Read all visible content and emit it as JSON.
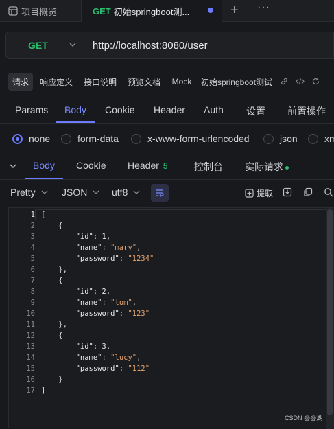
{
  "tabbar": {
    "overview_label": "项目概览",
    "active_tab": {
      "method": "GET",
      "title": "初始springboot测..."
    }
  },
  "request": {
    "method": "GET",
    "url": "http://localhost:8080/user"
  },
  "doc_tabs": [
    "请求",
    "响应定义",
    "接口说明",
    "预览文档",
    "Mock",
    "初始springboot测试"
  ],
  "param_tabs": [
    "Params",
    "Body",
    "Cookie",
    "Header",
    "Auth",
    "设置",
    "前置操作"
  ],
  "param_tabs_active": "Body",
  "body_types": [
    "none",
    "form-data",
    "x-www-form-urlencoded",
    "json",
    "xm"
  ],
  "body_type_selected": "none",
  "response_tabs": {
    "body": "Body",
    "cookie": "Cookie",
    "header": "Header",
    "header_count": "5",
    "console": "控制台",
    "actual_request": "实际请求"
  },
  "response_toolbar": {
    "format": "Pretty",
    "language": "JSON",
    "encoding": "utf8",
    "extract": "提取"
  },
  "code_lines": [
    {
      "n": "1",
      "tokens": [
        {
          "t": "brk",
          "v": "["
        }
      ]
    },
    {
      "n": "2",
      "tokens": [
        {
          "t": "brk",
          "v": "    {"
        }
      ]
    },
    {
      "n": "3",
      "tokens": [
        {
          "t": "pun",
          "v": "        "
        },
        {
          "t": "key",
          "v": "\"id\""
        },
        {
          "t": "pun",
          "v": ": "
        },
        {
          "t": "num",
          "v": "1"
        },
        {
          "t": "pun",
          "v": ","
        }
      ]
    },
    {
      "n": "4",
      "tokens": [
        {
          "t": "pun",
          "v": "        "
        },
        {
          "t": "key",
          "v": "\"name\""
        },
        {
          "t": "pun",
          "v": ": "
        },
        {
          "t": "str",
          "v": "\"mary\""
        },
        {
          "t": "pun",
          "v": ","
        }
      ]
    },
    {
      "n": "5",
      "tokens": [
        {
          "t": "pun",
          "v": "        "
        },
        {
          "t": "key",
          "v": "\"password\""
        },
        {
          "t": "pun",
          "v": ": "
        },
        {
          "t": "str",
          "v": "\"1234\""
        }
      ]
    },
    {
      "n": "6",
      "tokens": [
        {
          "t": "brk",
          "v": "    },"
        }
      ]
    },
    {
      "n": "7",
      "tokens": [
        {
          "t": "brk",
          "v": "    {"
        }
      ]
    },
    {
      "n": "8",
      "tokens": [
        {
          "t": "pun",
          "v": "        "
        },
        {
          "t": "key",
          "v": "\"id\""
        },
        {
          "t": "pun",
          "v": ": "
        },
        {
          "t": "num",
          "v": "2"
        },
        {
          "t": "pun",
          "v": ","
        }
      ]
    },
    {
      "n": "9",
      "tokens": [
        {
          "t": "pun",
          "v": "        "
        },
        {
          "t": "key",
          "v": "\"name\""
        },
        {
          "t": "pun",
          "v": ": "
        },
        {
          "t": "str",
          "v": "\"tom\""
        },
        {
          "t": "pun",
          "v": ","
        }
      ]
    },
    {
      "n": "10",
      "tokens": [
        {
          "t": "pun",
          "v": "        "
        },
        {
          "t": "key",
          "v": "\"password\""
        },
        {
          "t": "pun",
          "v": ": "
        },
        {
          "t": "str",
          "v": "\"123\""
        }
      ]
    },
    {
      "n": "11",
      "tokens": [
        {
          "t": "brk",
          "v": "    },"
        }
      ]
    },
    {
      "n": "12",
      "tokens": [
        {
          "t": "brk",
          "v": "    {"
        }
      ]
    },
    {
      "n": "13",
      "tokens": [
        {
          "t": "pun",
          "v": "        "
        },
        {
          "t": "key",
          "v": "\"id\""
        },
        {
          "t": "pun",
          "v": ": "
        },
        {
          "t": "num",
          "v": "3"
        },
        {
          "t": "pun",
          "v": ","
        }
      ]
    },
    {
      "n": "14",
      "tokens": [
        {
          "t": "pun",
          "v": "        "
        },
        {
          "t": "key",
          "v": "\"name\""
        },
        {
          "t": "pun",
          "v": ": "
        },
        {
          "t": "str",
          "v": "\"lucy\""
        },
        {
          "t": "pun",
          "v": ","
        }
      ]
    },
    {
      "n": "15",
      "tokens": [
        {
          "t": "pun",
          "v": "        "
        },
        {
          "t": "key",
          "v": "\"password\""
        },
        {
          "t": "pun",
          "v": ": "
        },
        {
          "t": "str",
          "v": "\"112\""
        }
      ]
    },
    {
      "n": "16",
      "tokens": [
        {
          "t": "brk",
          "v": "    }"
        }
      ]
    },
    {
      "n": "17",
      "tokens": [
        {
          "t": "brk",
          "v": "]"
        }
      ]
    }
  ],
  "watermark": "CSDN @@湖",
  "colors": {
    "accent": "#6b7cff",
    "method_get": "#2bbd6e",
    "string": "#e3a46e",
    "background": "#18191c"
  }
}
